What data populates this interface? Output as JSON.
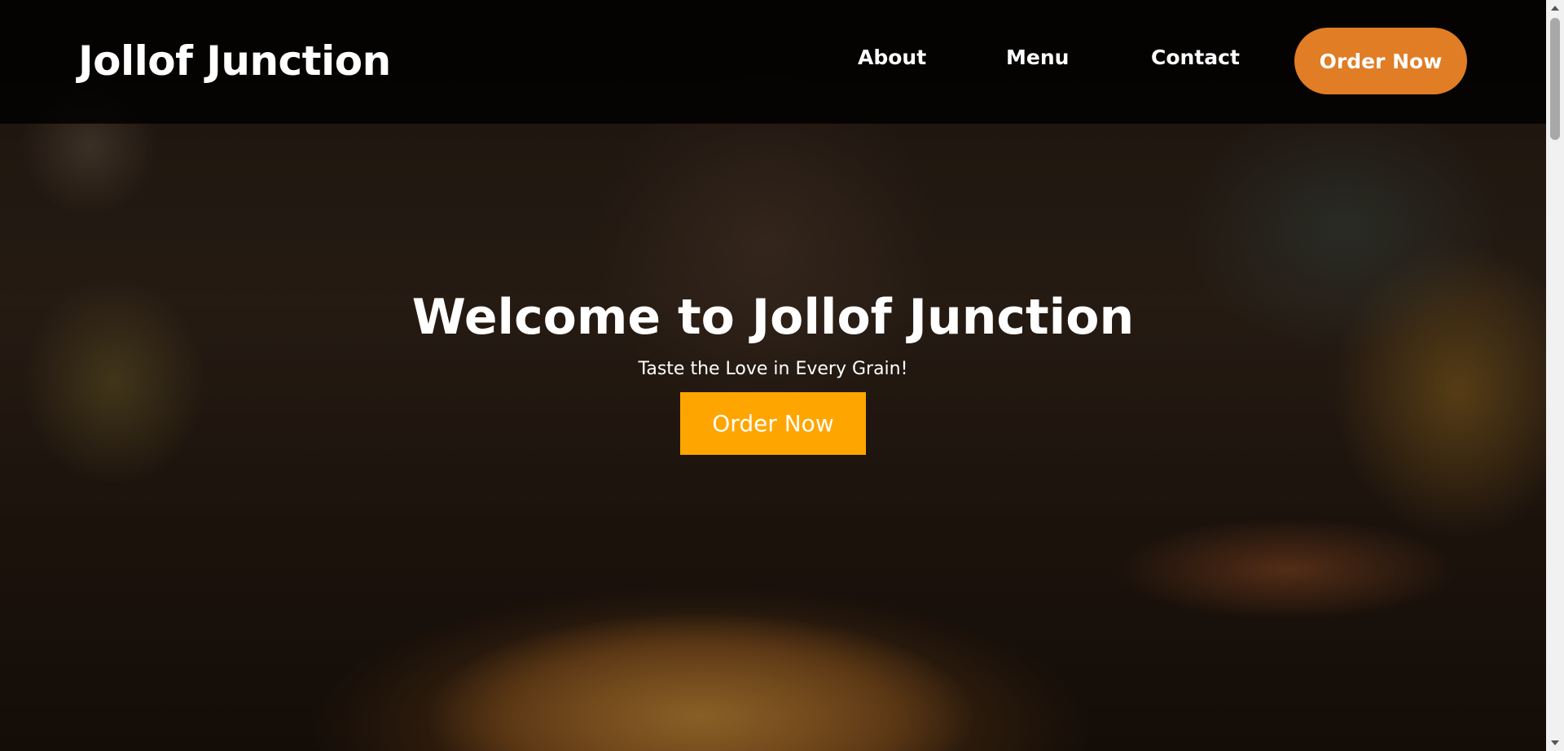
{
  "navbar": {
    "brand": "Jollof Junction",
    "links": [
      {
        "label": "About"
      },
      {
        "label": "Menu"
      },
      {
        "label": "Contact"
      }
    ],
    "order_button": "Order Now"
  },
  "hero": {
    "title": "Welcome to Jollof Junction",
    "subtitle": "Taste the Love in Every Grain!",
    "cta": "Order Now",
    "background_image": "jollof-rice-plate-photo"
  },
  "colors": {
    "nav_order_button": "#e07d25",
    "hero_cta_button": "#ffa500",
    "text": "#ffffff"
  },
  "icons": {
    "scroll_up": "scroll-up-arrow-icon",
    "scroll_down": "scroll-down-arrow-icon"
  }
}
